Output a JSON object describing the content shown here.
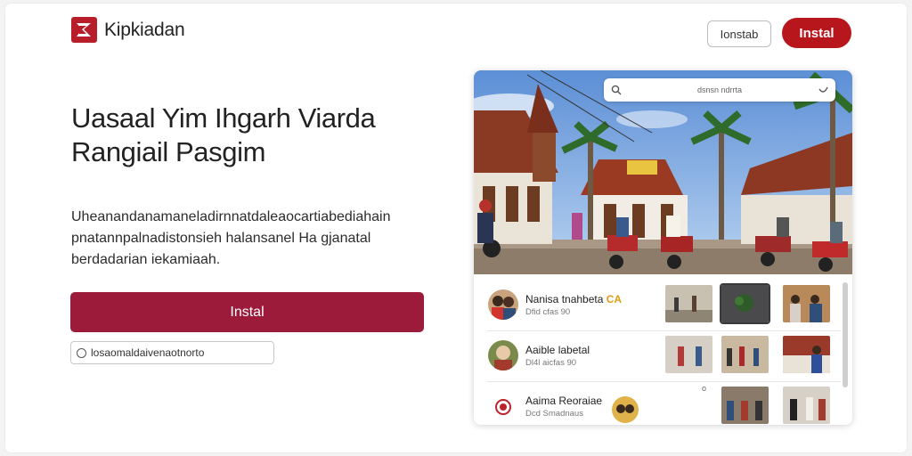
{
  "brand": {
    "name": "Kipkiadan"
  },
  "header": {
    "secondary_button": "Ionstab",
    "primary_button": "Instal"
  },
  "hero": {
    "title": "Uasaal Yim Ihgarh Viarda Rangiail Pasgim",
    "description": "Uheanandanamaneladirnnatdaleaocartiabediahain pnatannpalnadistonsieh halansanel Ha gjanatal berdadarian iekamiaah.",
    "install_button": "Instal",
    "link_text": "losaomaldaivenaotnorto"
  },
  "preview": {
    "search": {
      "text": "dsnsn ndrrta"
    },
    "items": [
      {
        "title": "Nanisa",
        "title_rest": "tnahbeta",
        "badge": "CA",
        "sub": "Dfid cfas 90"
      },
      {
        "title": "Aaible labetal",
        "title_rest": "",
        "badge": "",
        "sub": "Dl4l aicfas 90"
      },
      {
        "title": "Aaima Reoraiae",
        "title_rest": "",
        "badge": "",
        "sub": "Dcd Smadnaus"
      }
    ],
    "corner_note": "o"
  },
  "colors": {
    "accent": "#b8161d",
    "install": "#9c1b3a",
    "badge": "#e09b12"
  },
  "icons": [
    "brand-logo-icon",
    "search-icon",
    "mic-icon",
    "link-icon"
  ]
}
